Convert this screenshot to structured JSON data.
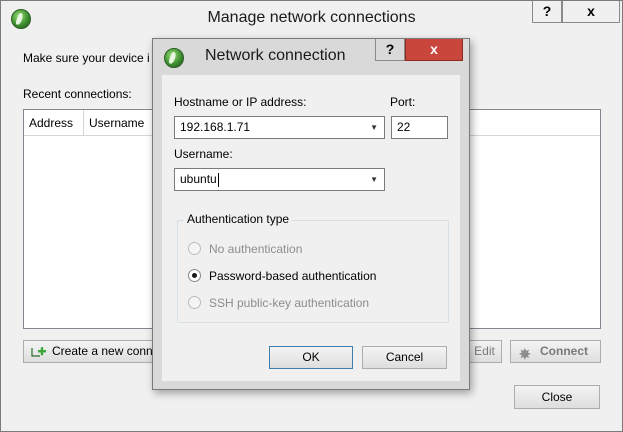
{
  "outer_window": {
    "title": "Manage network connections",
    "help_label": "?",
    "close_label": "x",
    "message": "Make sure your device i",
    "recent_label": "Recent connections:",
    "table": {
      "columns": [
        "Address",
        "Username"
      ],
      "rows": []
    },
    "create_label": "Create a new conn",
    "edit_label": "Edit",
    "connect_label": "Connect",
    "close_button_label": "Close"
  },
  "dialog": {
    "title": "Network connection",
    "help_label": "?",
    "close_label": "x",
    "host_label": "Hostname or IP address:",
    "host_value": "192.168.1.71",
    "port_label": "Port:",
    "port_value": "22",
    "username_label": "Username:",
    "username_value": "ubuntu",
    "auth_group_label": "Authentication type",
    "auth_options": [
      {
        "label": "No authentication",
        "selected": false,
        "enabled": false
      },
      {
        "label": "Password-based authentication",
        "selected": true,
        "enabled": true
      },
      {
        "label": "SSH public-key authentication",
        "selected": false,
        "enabled": false
      }
    ],
    "ok_label": "OK",
    "cancel_label": "Cancel"
  },
  "icons": {
    "app": "app-globe-icon",
    "create": "add-connection-icon",
    "connect": "plug-icon",
    "dropdown": "chevron-down-icon"
  },
  "colors": {
    "dialog_close": "#c8463c",
    "window_bg": "#f0f0f0",
    "dialog_frame": "#d9d9d9"
  }
}
